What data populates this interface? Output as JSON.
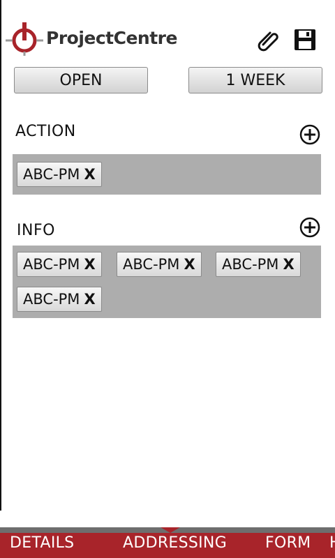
{
  "header": {
    "app_name": "ProjectCentre",
    "icons": [
      "logo-crosshair",
      "paperclip-icon",
      "save-floppy-icon"
    ],
    "brand_color": "#a8242a"
  },
  "filters": {
    "status_button": "OPEN",
    "period_button": "1 WEEK"
  },
  "sections": {
    "action": {
      "label": "ACTION",
      "chips": [
        {
          "text": "ABC-PM",
          "remove": "X"
        }
      ]
    },
    "info": {
      "label": "INFO",
      "chips": [
        {
          "text": "ABC-PM",
          "remove": "X"
        },
        {
          "text": "ABC-PM",
          "remove": "X"
        },
        {
          "text": "ABC-PM",
          "remove": "X"
        },
        {
          "text": "ABC-PM",
          "remove": "X"
        }
      ]
    }
  },
  "tabs": [
    {
      "label": "DETAILS"
    },
    {
      "label": "ADDRESSING",
      "selected": true
    },
    {
      "label": "FORM"
    },
    {
      "label": "H"
    }
  ]
}
